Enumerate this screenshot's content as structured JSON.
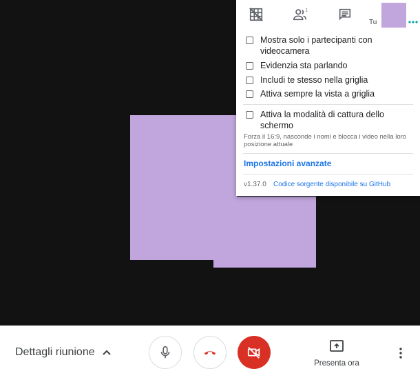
{
  "colors": {
    "stage_bg": "#121212",
    "tile_color": "#c0a6dc",
    "tile_shade": "#8e72ad",
    "accent_blue": "#1a73e8",
    "danger_red": "#d93025",
    "dots_teal": "#00a0a0"
  },
  "panel": {
    "tabs": [
      {
        "icon": "grid-off-icon"
      },
      {
        "icon": "people-icon"
      },
      {
        "icon": "chat-icon"
      }
    ],
    "self_label": "Tu",
    "options": [
      {
        "label": "Mostra solo i partecipanti con videocamera",
        "checked": false
      },
      {
        "label": "Evidenzia sta parlando",
        "checked": false
      },
      {
        "label": "Includi te stesso nella griglia",
        "checked": false
      },
      {
        "label": "Attiva sempre la vista a griglia",
        "checked": false
      },
      {
        "label": "Attiva la modalità di cattura dello schermo",
        "checked": false
      }
    ],
    "capture_note": "Forza il 16:9, nasconde i nomi e blocca i video nella loro posizione attuale",
    "advanced_link": "Impostazioni avanzate",
    "version": "v1.37.0",
    "source_link": "Codice sorgente disponibile su GitHub"
  },
  "bottom_bar": {
    "details_label": "Dettagli riunione",
    "present_label": "Presenta ora"
  }
}
